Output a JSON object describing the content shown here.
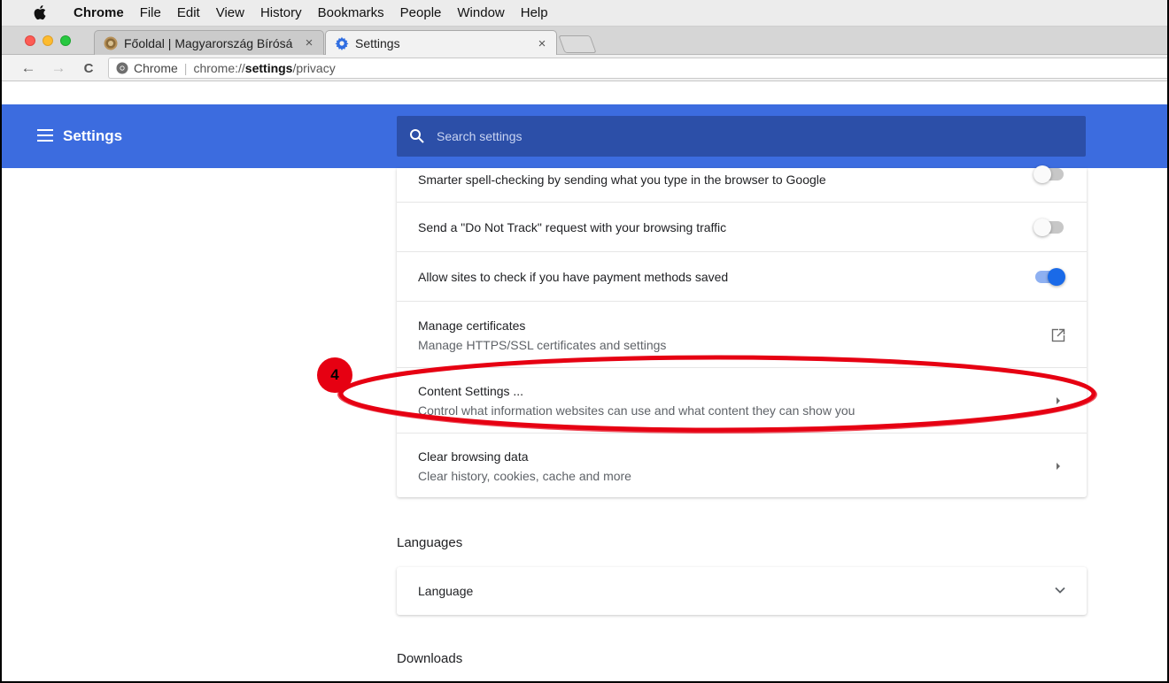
{
  "menubar": {
    "apple_icon": "apple-icon",
    "items": [
      {
        "label": "Chrome",
        "bold": true
      },
      {
        "label": "File"
      },
      {
        "label": "Edit"
      },
      {
        "label": "View"
      },
      {
        "label": "History"
      },
      {
        "label": "Bookmarks"
      },
      {
        "label": "People"
      },
      {
        "label": "Window"
      },
      {
        "label": "Help"
      }
    ]
  },
  "tabs": [
    {
      "label": "Főoldal | Magyarország Bírósá",
      "close": "×",
      "icon": "court-seal-icon",
      "active": false
    },
    {
      "label": "Settings",
      "close": "×",
      "icon": "gear-icon",
      "active": true
    }
  ],
  "toolbar": {
    "back": "←",
    "forward": "→",
    "reload": "C",
    "secure_label": "Chrome",
    "separator": "|",
    "url_prefix": "chrome://",
    "url_host": "settings",
    "url_path": "/privacy"
  },
  "header": {
    "title": "Settings",
    "search_placeholder": "Search settings",
    "bg_color": "#3c6cdf"
  },
  "privacy_rows": [
    {
      "title": "",
      "subtitle": "Smarter spell-checking by sending what you type in the browser to Google",
      "control": "toggle",
      "checked": false
    },
    {
      "title": "Send a \"Do Not Track\" request with your browsing traffic",
      "subtitle": "",
      "control": "toggle",
      "checked": false
    },
    {
      "title": "Allow sites to check if you have payment methods saved",
      "subtitle": "",
      "control": "toggle",
      "checked": true
    },
    {
      "title": "Manage certificates",
      "subtitle": "Manage HTTPS/SSL certificates and settings",
      "control": "external-link"
    },
    {
      "title": "Content Settings ...",
      "subtitle": "Control what information websites can use and what content they can show you",
      "control": "arrow"
    },
    {
      "title": "Clear browsing data",
      "subtitle": "Clear history, cookies, cache and more",
      "control": "arrow"
    }
  ],
  "languages": {
    "section_title": "Languages",
    "item_label": "Language"
  },
  "downloads": {
    "section_title": "Downloads"
  },
  "annotation": {
    "step_number": "4",
    "color": "#e60012"
  }
}
